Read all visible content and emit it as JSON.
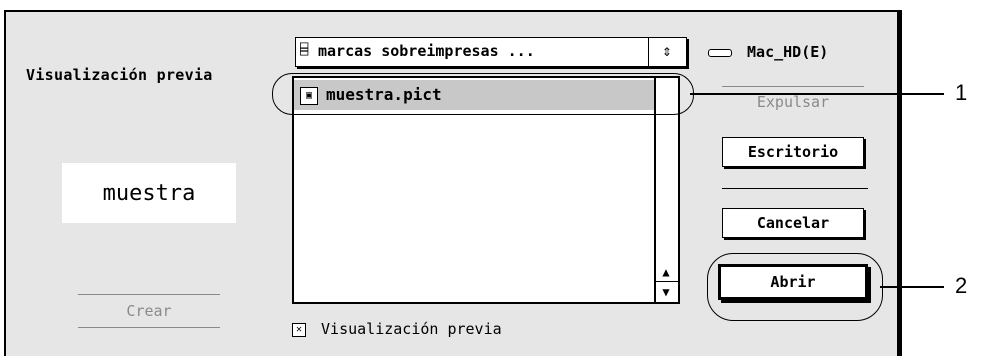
{
  "preview_panel": {
    "heading": "Visualización previa",
    "preview_text": "muestra",
    "create_button": "Crear"
  },
  "folder_popup": {
    "icon": "folder-icon",
    "selected_folder": "marcas sobreimpresas ...",
    "arrows": "⇕"
  },
  "volume": {
    "icon": "disk-icon",
    "name": "Mac_HD(E)"
  },
  "file_list": {
    "files": [
      {
        "name": "muestra.pict",
        "icon": "pict-file-icon",
        "selected": true
      }
    ]
  },
  "preview_checkbox": {
    "label": "Visualización previa",
    "checked": true
  },
  "buttons": {
    "eject": "Expulsar",
    "desktop": "Escritorio",
    "cancel": "Cancelar",
    "open": "Abrir"
  },
  "callouts": {
    "one": "1",
    "two": "2"
  }
}
